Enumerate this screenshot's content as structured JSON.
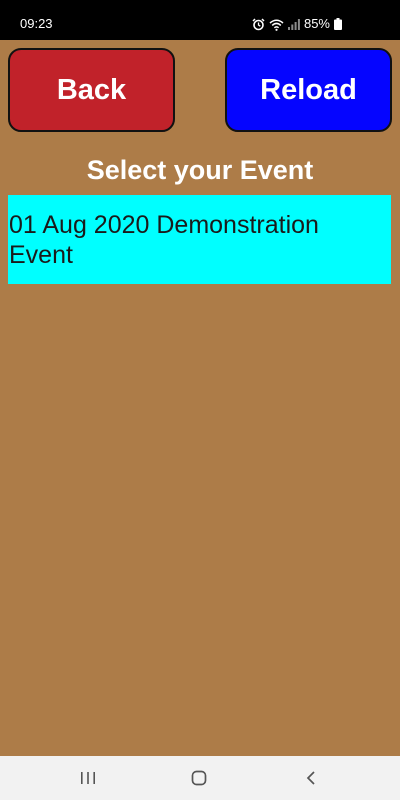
{
  "status_bar": {
    "time": "09:23",
    "battery": "85%",
    "icons": [
      "alarm-icon",
      "wifi-icon",
      "signal-icon",
      "battery-icon"
    ]
  },
  "toolbar": {
    "back_label": "Back",
    "reload_label": "Reload"
  },
  "main": {
    "heading": "Select your Event",
    "events": [
      {
        "label": "01 Aug 2020 Demonstration Event"
      }
    ]
  },
  "nav_bar": {
    "icons": [
      "recent-apps-icon",
      "home-icon",
      "back-arrow-icon"
    ]
  },
  "colors": {
    "background": "#ad7c48",
    "back_button": "#c1222a",
    "reload_button": "#0505ff",
    "event_highlight": "#00ffff",
    "status_bar": "#000000",
    "nav_bar": "#f2f2f2"
  }
}
